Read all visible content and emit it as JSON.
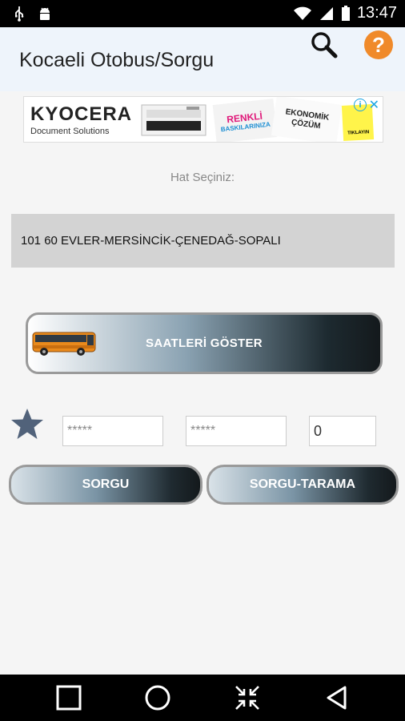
{
  "status_bar": {
    "time": "13:47",
    "icons": [
      "usb-icon",
      "android-icon",
      "wifi-icon",
      "signal-icon",
      "battery-icon"
    ]
  },
  "app_bar": {
    "title": "Kocaeli Otobus/Sorgu",
    "actions": [
      "search-icon",
      "help-icon"
    ],
    "help_label": "?"
  },
  "ad": {
    "brand": "KYOCERA",
    "sub": "Document Solutions",
    "card1_top": "RENKLİ",
    "card1_bottom": "BASKILARINIZA",
    "card2_top": "EKONOMİK",
    "card2_bottom": "ÇÖZÜM",
    "card3": "TIKLAYIN",
    "choice_icon": "adchoices-icon",
    "close": "✕"
  },
  "form": {
    "hat_label": "Hat Seçiniz:",
    "route_value": "101 60 EVLER-MERSİNCİK-ÇENEDAĞ-SOPALI",
    "show_button": "SAATLERİ GÖSTER",
    "field1": "*****",
    "field2": "*****",
    "field3": "0",
    "sorgu_button": "SORGU",
    "tarama_button": "SORGU-TARAMA"
  },
  "colors": {
    "accent_orange": "#f08a2a",
    "appbar_bg": "#eef4fb",
    "star": "#51627a"
  },
  "nav_bar": [
    "recents-icon",
    "home-icon",
    "collapse-icon",
    "back-icon"
  ]
}
